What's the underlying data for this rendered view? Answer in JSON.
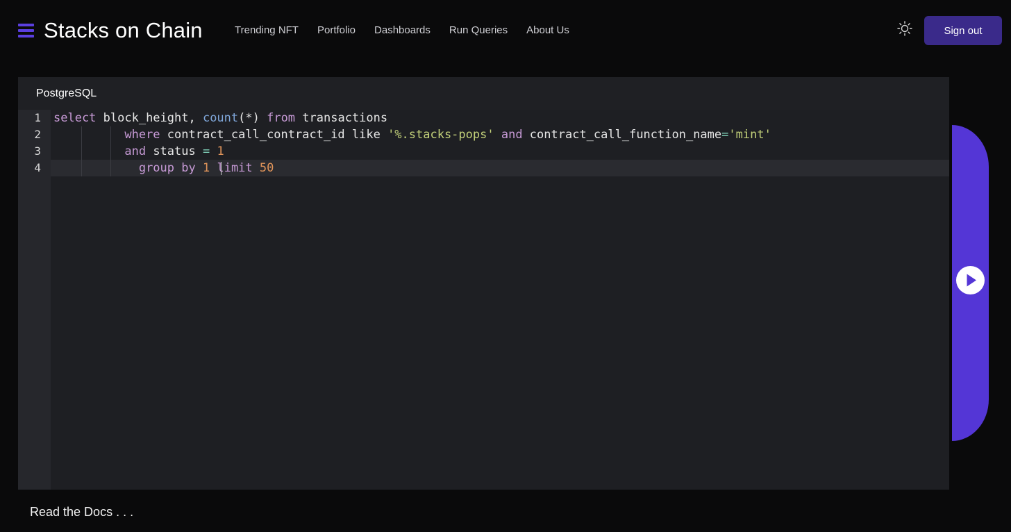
{
  "header": {
    "brand": "Stacks on Chain",
    "nav": [
      "Trending NFT",
      "Portfolio",
      "Dashboards",
      "Run Queries",
      "About Us"
    ],
    "signout_label": "Sign out",
    "icons": {
      "menu": "hamburger-menu-icon",
      "theme": "sun-icon"
    }
  },
  "editor": {
    "language": "PostgreSQL",
    "line_numbers": [
      "1",
      "2",
      "3",
      "4"
    ],
    "active_line": "4",
    "lines": [
      [
        {
          "t": "select",
          "c": "kw"
        },
        {
          "t": " block_height, ",
          "c": ""
        },
        {
          "t": "count",
          "c": "fn"
        },
        {
          "t": "(*) ",
          "c": ""
        },
        {
          "t": "from",
          "c": "kw"
        },
        {
          "t": " transactions",
          "c": ""
        }
      ],
      [
        {
          "t": "          ",
          "c": ""
        },
        {
          "t": "where",
          "c": "kw"
        },
        {
          "t": " contract_call_contract_id like ",
          "c": ""
        },
        {
          "t": "'%.stacks-pops'",
          "c": "str"
        },
        {
          "t": " ",
          "c": ""
        },
        {
          "t": "and",
          "c": "kw"
        },
        {
          "t": " contract_call_function_name",
          "c": ""
        },
        {
          "t": "=",
          "c": "op"
        },
        {
          "t": "'mint'",
          "c": "str"
        }
      ],
      [
        {
          "t": "          ",
          "c": ""
        },
        {
          "t": "and",
          "c": "kw"
        },
        {
          "t": " status ",
          "c": ""
        },
        {
          "t": "=",
          "c": "op"
        },
        {
          "t": " ",
          "c": ""
        },
        {
          "t": "1",
          "c": "num"
        }
      ],
      [
        {
          "t": "            ",
          "c": ""
        },
        {
          "t": "group by",
          "c": "kw"
        },
        {
          "t": " ",
          "c": ""
        },
        {
          "t": "1",
          "c": "num"
        },
        {
          "t": " ",
          "c": ""
        },
        {
          "t": "limit",
          "c": "kw"
        },
        {
          "t": " ",
          "c": ""
        },
        {
          "t": "50",
          "c": "num"
        }
      ]
    ]
  },
  "run_panel": {
    "icon": "play-icon"
  },
  "footer": {
    "docs_link": "Read the Docs . . ."
  },
  "colors": {
    "accent": "#5436d6",
    "button": "#3a2a8a",
    "background": "#0a0a0b"
  }
}
